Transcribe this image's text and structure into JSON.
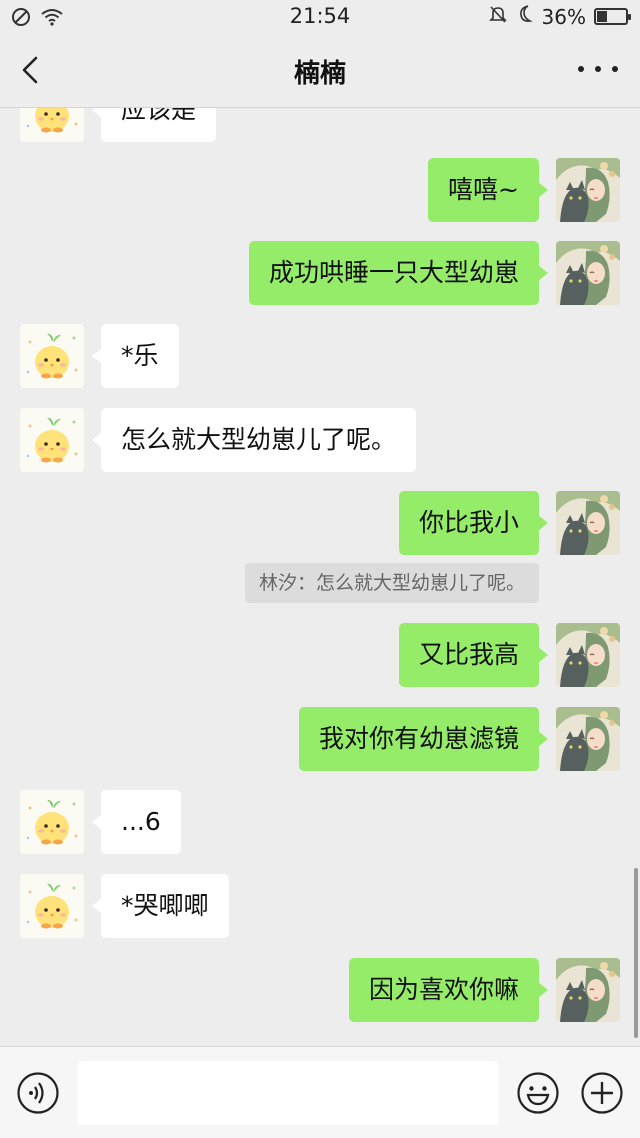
{
  "status_bar": {
    "time": "21:54",
    "battery": "36%",
    "battery_level": 0.36
  },
  "header": {
    "title": "楠楠",
    "back_icon": "chevron-left-icon",
    "more_icon": "more-dots-icon"
  },
  "messages": [
    {
      "side": "in",
      "text": "应该是"
    },
    {
      "side": "out",
      "text": "嘻嘻~"
    },
    {
      "side": "out",
      "text": "成功哄睡一只大型幼崽"
    },
    {
      "side": "in",
      "text": "*乐"
    },
    {
      "side": "in",
      "text": "怎么就大型幼崽儿了呢。"
    },
    {
      "side": "out",
      "text": "你比我小"
    },
    {
      "side": "out",
      "text": "又比我高"
    },
    {
      "side": "out",
      "text": "我对你有幼崽滤镜"
    },
    {
      "side": "in",
      "text": "...6"
    },
    {
      "side": "in",
      "text": "*哭唧唧"
    },
    {
      "side": "out",
      "text": "因为喜欢你嘛"
    }
  ],
  "quote": {
    "text": "林汐：怎么就大型幼崽儿了呢。"
  },
  "input_bar": {
    "voice_icon": "voice-icon",
    "emoji_icon": "emoji-icon",
    "plus_icon": "plus-icon",
    "field_value": ""
  },
  "colors": {
    "background": "#ededed",
    "outgoing_bubble": "#95ec69",
    "incoming_bubble": "#ffffff"
  }
}
